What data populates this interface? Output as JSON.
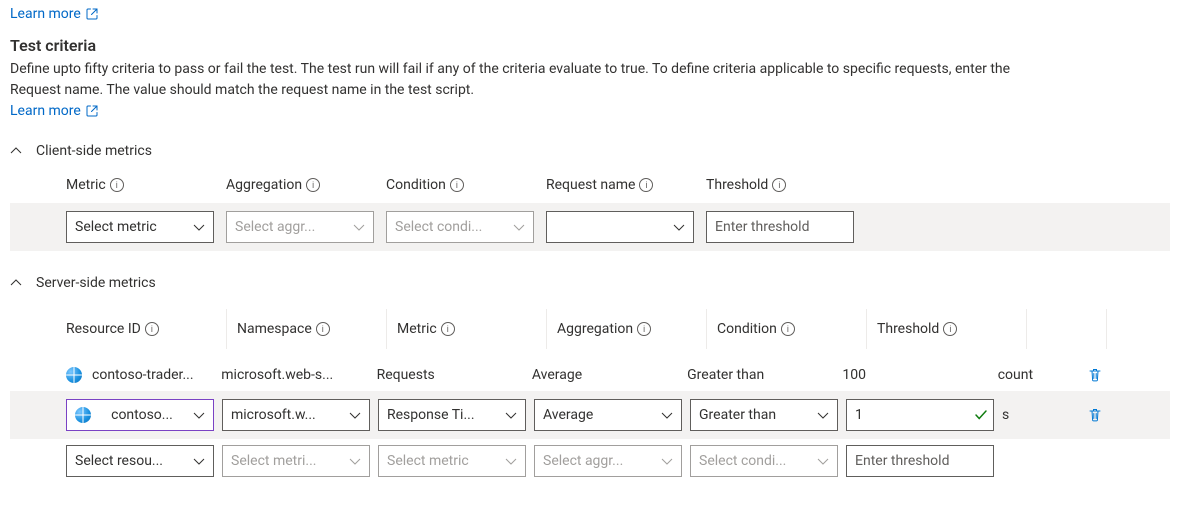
{
  "top_learn_more": "Learn more",
  "section": {
    "title": "Test criteria",
    "description": "Define upto fifty criteria to pass or fail the test. The test run will fail if any of the criteria evaluate to true. To define criteria applicable to specific requests, enter the Request name. The value should match the request name in the test script.",
    "learn_more": "Learn more"
  },
  "client": {
    "heading": "Client-side metrics",
    "headers": {
      "metric": "Metric",
      "aggregation": "Aggregation",
      "condition": "Condition",
      "request_name": "Request name",
      "threshold": "Threshold"
    },
    "row": {
      "metric_placeholder": "Select metric",
      "aggregation_placeholder": "Select aggr...",
      "condition_placeholder": "Select condi...",
      "request_value": "",
      "threshold_placeholder": "Enter threshold"
    }
  },
  "server": {
    "heading": "Server-side metrics",
    "headers": {
      "resource_id": "Resource ID",
      "namespace": "Namespace",
      "metric": "Metric",
      "aggregation": "Aggregation",
      "condition": "Condition",
      "threshold": "Threshold"
    },
    "rows": [
      {
        "resource": "contoso-trader...",
        "namespace": "microsoft.web-s...",
        "metric": "Requests",
        "aggregation": "Average",
        "condition": "Greater than",
        "threshold": "100",
        "unit": "count",
        "mode": "readonly"
      },
      {
        "resource": "contoso...",
        "namespace": "microsoft.w...",
        "metric": "Response Ti...",
        "aggregation": "Average",
        "condition": "Greater than",
        "threshold": "1",
        "unit": "s",
        "mode": "editing"
      },
      {
        "resource_placeholder": "Select resou...",
        "namespace_placeholder": "Select metri...",
        "metric_placeholder": "Select metric",
        "aggregation_placeholder": "Select aggr...",
        "condition_placeholder": "Select condi...",
        "threshold_placeholder": "Enter threshold",
        "mode": "empty"
      }
    ]
  }
}
